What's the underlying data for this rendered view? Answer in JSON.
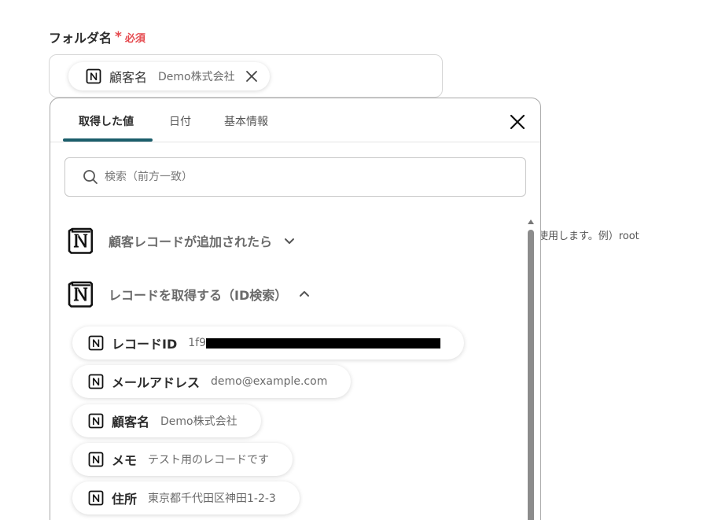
{
  "field": {
    "label": "フォルダ名",
    "required_mark": "*",
    "required_text": "必須",
    "chip": {
      "key": "顧客名",
      "value": "Demo株式会社"
    }
  },
  "side_hint": "使用します。例）root",
  "popup": {
    "tabs": [
      {
        "label": "取得した値",
        "active": true
      },
      {
        "label": "日付",
        "active": false
      },
      {
        "label": "基本情報",
        "active": false
      }
    ],
    "search": {
      "placeholder": "検索（前方一致）",
      "value": ""
    },
    "sections": [
      {
        "title": "顧客レコードが追加されたら",
        "expanded": false
      },
      {
        "title": "レコードを取得する（ID検索）",
        "expanded": true,
        "items": [
          {
            "key": "レコードID",
            "value": "1f9"
          },
          {
            "key": "メールアドレス",
            "value": "demo@example.com"
          },
          {
            "key": "顧客名",
            "value": "Demo株式会社"
          },
          {
            "key": "メモ",
            "value": "テスト用のレコードです"
          },
          {
            "key": "住所",
            "value": "東京都千代田区神田1-2-3"
          }
        ]
      }
    ]
  },
  "colors": {
    "accent": "#1b5e6b",
    "required": "#e5484d"
  },
  "icons": {
    "app": "notion-icon",
    "close": "close-icon",
    "search": "search-icon"
  }
}
